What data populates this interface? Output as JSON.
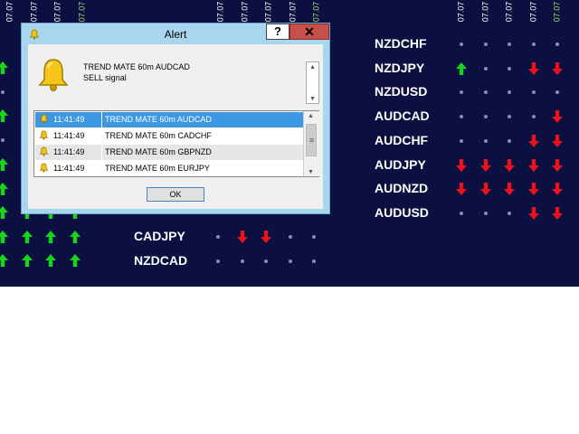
{
  "panel": {
    "date_label": "07.07",
    "colors": {
      "background": "#0b1040",
      "up": "#16d61b",
      "down": "#e8141c",
      "neutral": "#8a8fb0"
    },
    "date_headers_left": [
      {
        "text": "07.07",
        "color": "#ffffff"
      },
      {
        "text": "07.07",
        "color": "#ffffff"
      },
      {
        "text": "07.07",
        "color": "#ffffff"
      },
      {
        "text": "07.07",
        "color": "#9fe06a"
      }
    ],
    "date_headers_mid": [
      {
        "text": "07.07",
        "color": "#ffffff"
      },
      {
        "text": "07.07",
        "color": "#ffffff"
      },
      {
        "text": "07.07",
        "color": "#ffffff"
      },
      {
        "text": "07.07",
        "color": "#ffffff"
      },
      {
        "text": "07.07",
        "color": "#9fe06a"
      }
    ],
    "date_headers_right": [
      {
        "text": "07.07",
        "color": "#ffffff"
      },
      {
        "text": "07.07",
        "color": "#ffffff"
      },
      {
        "text": "07.07",
        "color": "#ffffff"
      },
      {
        "text": "07.07",
        "color": "#ffffff"
      },
      {
        "text": "07.07",
        "color": "#9fe06a"
      }
    ],
    "left_pairs": [
      {
        "name": "CADJPY",
        "signals": [
          "dot",
          "down",
          "down",
          "dot",
          "dot"
        ]
      },
      {
        "name": "NZDCAD",
        "signals": [
          "dot",
          "dot",
          "dot",
          "dot",
          "dot"
        ]
      }
    ],
    "left_edge_rows": [
      [
        "up"
      ],
      [
        "dot"
      ],
      [
        "up"
      ],
      [
        "dot"
      ],
      [
        "up"
      ],
      [
        "up"
      ],
      [
        "dot"
      ],
      [
        "up"
      ]
    ],
    "left_grid_rows": [
      [
        "up",
        "up",
        "up",
        "up"
      ],
      [
        "up",
        "up",
        "up",
        "up"
      ],
      [
        "up",
        "up",
        "up",
        "up"
      ]
    ],
    "right_pairs": [
      {
        "name": "NZDCHF",
        "signals": [
          "dot",
          "dot",
          "dot",
          "dot",
          "dot"
        ]
      },
      {
        "name": "NZDJPY",
        "signals": [
          "up",
          "dot",
          "dot",
          "down",
          "down"
        ]
      },
      {
        "name": "NZDUSD",
        "signals": [
          "dot",
          "dot",
          "dot",
          "dot",
          "dot"
        ]
      },
      {
        "name": "AUDCAD",
        "signals": [
          "dot",
          "dot",
          "dot",
          "dot",
          "down"
        ]
      },
      {
        "name": "AUDCHF",
        "signals": [
          "dot",
          "dot",
          "dot",
          "down",
          "down"
        ]
      },
      {
        "name": "AUDJPY",
        "signals": [
          "down",
          "down",
          "down",
          "down",
          "down"
        ]
      },
      {
        "name": "AUDNZD",
        "signals": [
          "down",
          "down",
          "down",
          "down",
          "down"
        ]
      },
      {
        "name": "AUDUSD",
        "signals": [
          "dot",
          "dot",
          "dot",
          "down",
          "down"
        ]
      }
    ]
  },
  "dialog": {
    "title": "Alert",
    "help_label": "?",
    "close_label": "✕",
    "message_line1": "TREND MATE 60m AUDCAD",
    "message_line2": "SELL signal",
    "icon": "bell-icon",
    "alerts": [
      {
        "time": "11:41:49",
        "text": "TREND MATE 60m AUDCAD",
        "selected": true
      },
      {
        "time": "11:41:49",
        "text": "TREND MATE 60m CADCHF",
        "selected": false
      },
      {
        "time": "11:41:49",
        "text": "TREND MATE 60m GBPNZD",
        "selected": false
      },
      {
        "time": "11:41:49",
        "text": "TREND MATE 60m EURJPY",
        "selected": false
      }
    ],
    "ok_label": "OK"
  }
}
